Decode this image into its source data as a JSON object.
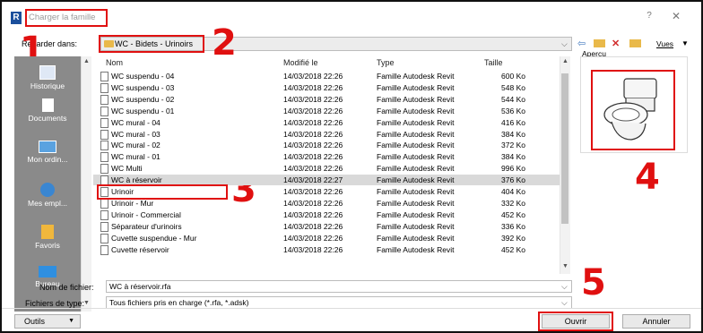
{
  "window": {
    "title": "Charger la famille",
    "help_glyph": "?",
    "close_glyph": "✕",
    "app_logo": "R"
  },
  "toolbar": {
    "look_in_label": "Regarder dans:",
    "look_in_value": "WC - Bidets - Urinoirs",
    "views_label": "Vues",
    "icons": [
      "back-arrow-icon",
      "folder-up-icon",
      "delete-icon",
      "new-folder-icon"
    ]
  },
  "callouts": [
    "1",
    "2",
    "3",
    "4",
    "5"
  ],
  "sidebar": {
    "items": [
      {
        "label": "Historique",
        "icon": "history-icon"
      },
      {
        "label": "Documents",
        "icon": "documents-icon"
      },
      {
        "label": "Mon ordin...",
        "icon": "computer-icon"
      },
      {
        "label": "Mes empl...",
        "icon": "network-icon"
      },
      {
        "label": "Favoris",
        "icon": "favorites-icon"
      },
      {
        "label": "Bureau",
        "icon": "desktop-icon"
      }
    ]
  },
  "file_list": {
    "columns": [
      "Nom",
      "Modifié le",
      "Type",
      "Taille"
    ],
    "rows": [
      {
        "name": "WC suspendu - 04",
        "date": "14/03/2018 22:26",
        "type": "Famille Autodesk Revit",
        "size": "600 Ko"
      },
      {
        "name": "WC suspendu - 03",
        "date": "14/03/2018 22:26",
        "type": "Famille Autodesk Revit",
        "size": "548 Ko"
      },
      {
        "name": "WC suspendu - 02",
        "date": "14/03/2018 22:26",
        "type": "Famille Autodesk Revit",
        "size": "544 Ko"
      },
      {
        "name": "WC suspendu - 01",
        "date": "14/03/2018 22:26",
        "type": "Famille Autodesk Revit",
        "size": "536 Ko"
      },
      {
        "name": "WC mural - 04",
        "date": "14/03/2018 22:26",
        "type": "Famille Autodesk Revit",
        "size": "416 Ko"
      },
      {
        "name": "WC mural - 03",
        "date": "14/03/2018 22:26",
        "type": "Famille Autodesk Revit",
        "size": "384 Ko"
      },
      {
        "name": "WC mural - 02",
        "date": "14/03/2018 22:26",
        "type": "Famille Autodesk Revit",
        "size": "372 Ko"
      },
      {
        "name": "WC mural - 01",
        "date": "14/03/2018 22:26",
        "type": "Famille Autodesk Revit",
        "size": "384 Ko"
      },
      {
        "name": "WC Multi",
        "date": "14/03/2018 22:26",
        "type": "Famille Autodesk Revit",
        "size": "996 Ko"
      },
      {
        "name": "WC à réservoir",
        "date": "14/03/2018 22:27",
        "type": "Famille Autodesk Revit",
        "size": "376 Ko",
        "selected": true
      },
      {
        "name": "Urinoir",
        "date": "14/03/2018 22:26",
        "type": "Famille Autodesk Revit",
        "size": "404 Ko"
      },
      {
        "name": "Urinoir - Mur",
        "date": "14/03/2018 22:26",
        "type": "Famille Autodesk Revit",
        "size": "332 Ko"
      },
      {
        "name": "Urinoir - Commercial",
        "date": "14/03/2018 22:26",
        "type": "Famille Autodesk Revit",
        "size": "452 Ko"
      },
      {
        "name": "Séparateur d'urinoirs",
        "date": "14/03/2018 22:26",
        "type": "Famille Autodesk Revit",
        "size": "336 Ko"
      },
      {
        "name": "Cuvette suspendue - Mur",
        "date": "14/03/2018 22:26",
        "type": "Famille Autodesk Revit",
        "size": "392 Ko"
      },
      {
        "name": "Cuvette réservoir",
        "date": "14/03/2018 22:26",
        "type": "Famille Autodesk Revit",
        "size": "452 Ko"
      }
    ]
  },
  "preview": {
    "label": "Aperçu"
  },
  "form": {
    "filename_label": "Nom de fichier:",
    "filename_value": "WC à réservoir.rfa",
    "filetype_label": "Fichiers de type:",
    "filetype_value": "Tous fichiers pris en charge  (*.rfa, *.adsk)"
  },
  "buttons": {
    "tools": "Outils",
    "open": "Ouvrir",
    "cancel": "Annuler"
  },
  "colors": {
    "callout_red": "#e01010",
    "sidebar_gray": "#8a8a8a",
    "folder_yellow": "#e9b94a",
    "selected_row": "#d9d9d9"
  }
}
